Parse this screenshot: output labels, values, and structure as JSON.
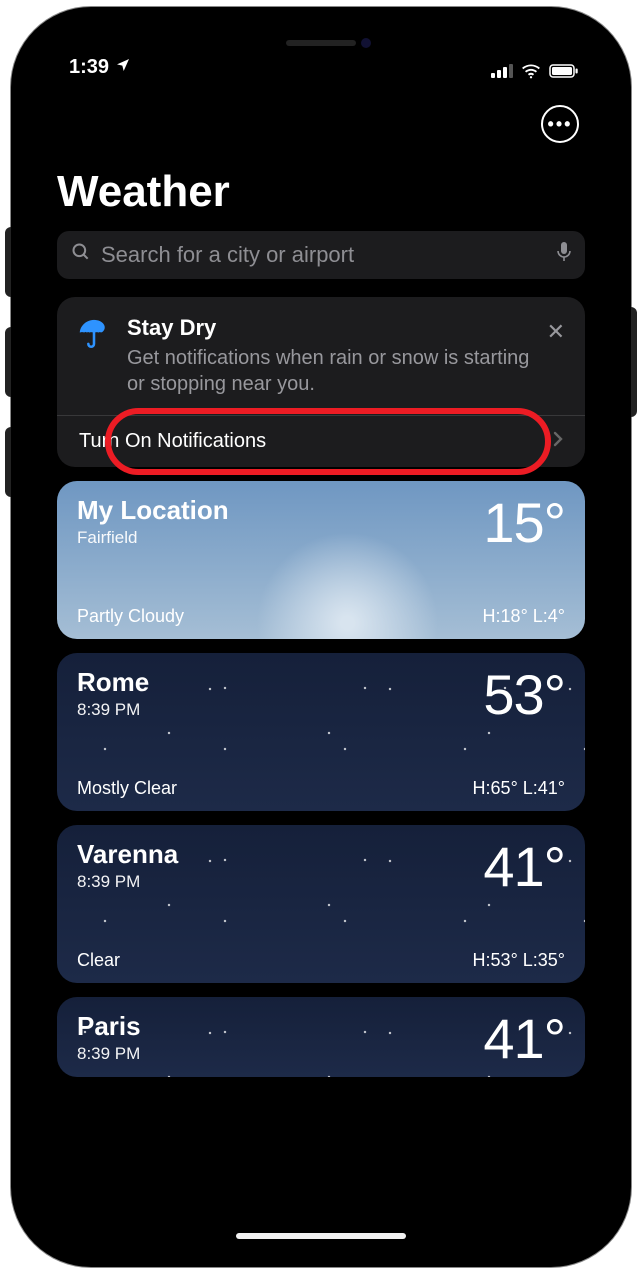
{
  "statusbar": {
    "time": "1:39"
  },
  "header": {
    "title": "Weather"
  },
  "search": {
    "placeholder": "Search for a city or airport"
  },
  "notif": {
    "title": "Stay Dry",
    "body": "Get notifications when rain or snow is starting or stopping near you.",
    "action_label": "Turn On Notifications"
  },
  "tiles": [
    {
      "city": "My Location",
      "sub": "Fairfield",
      "temp": "15°",
      "cond": "Partly Cloudy",
      "hl": "H:18° L:4°",
      "bg": "bg-partly"
    },
    {
      "city": "Rome",
      "sub": "8:39 PM",
      "temp": "53°",
      "cond": "Mostly Clear",
      "hl": "H:65° L:41°",
      "bg": "bg-night"
    },
    {
      "city": "Varenna",
      "sub": "8:39 PM",
      "temp": "41°",
      "cond": "Clear",
      "hl": "H:53° L:35°",
      "bg": "bg-night"
    },
    {
      "city": "Paris",
      "sub": "8:39 PM",
      "temp": "41°",
      "cond": "",
      "hl": "",
      "bg": "bg-night",
      "partial": true
    }
  ]
}
